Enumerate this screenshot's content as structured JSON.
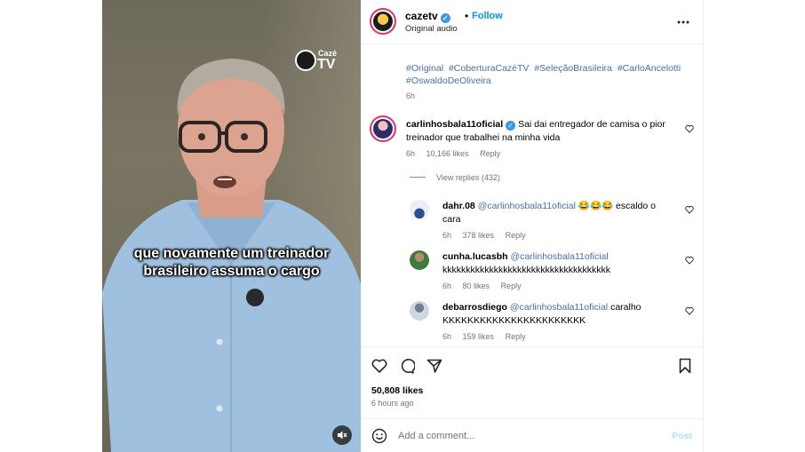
{
  "video": {
    "brand_small": "Cazé",
    "brand_big": "TV",
    "caption_line1": "que novamente um treinador",
    "caption_line2": "brasileiro assuma o cargo",
    "mute_icon": "speaker-muted-icon"
  },
  "header": {
    "username": "cazetv",
    "dot": "•",
    "follow_label": "Follow",
    "audio": "Original audio",
    "more_icon": "more-horizontal-icon"
  },
  "post": {
    "hashtags": [
      "#Original",
      "#CoberturaCazéTV",
      "#SeleçãoBrasileira",
      "#CarloAncelotti",
      "#OswaldoDeOliveira"
    ],
    "time": "6h"
  },
  "comments": [
    {
      "user": "carlinhosbala11oficial",
      "verified": true,
      "text": "Sai dai entregador de camisa o pior treinador que trabalhei na minha vida",
      "time": "6h",
      "likes": "10,166 likes",
      "reply": "Reply"
    }
  ],
  "view_replies": "View replies (432)",
  "replies": [
    {
      "user": "dahr.08",
      "mention": "@carlinhosbala11oficial",
      "text": "😂😂😂 escaldo o cara",
      "time": "6h",
      "likes": "378 likes",
      "reply": "Reply"
    },
    {
      "user": "cunha.lucasbh",
      "mention": "@carlinhosbala11oficial",
      "text": "kkkkkkkkkkkkkkkkkkkkkkkkkkkkkkkkkkkk",
      "time": "6h",
      "likes": "80 likes",
      "reply": "Reply"
    },
    {
      "user": "debarrosdiego",
      "mention": "@carlinhosbala11oficial",
      "text": "caralho KKKKKKKKKKKKKKKKKKKKKKK",
      "time": "6h",
      "likes": "159 likes",
      "reply": "Reply"
    }
  ],
  "actions": {
    "likes": "50,808 likes",
    "ago": "6 hours ago"
  },
  "add_comment": {
    "placeholder": "Add a comment...",
    "post_label": "Post"
  },
  "colors": {
    "link": "#4a6ea9",
    "follow": "#0095f6",
    "muted_text": "#737373",
    "verified": "#3897f0"
  }
}
